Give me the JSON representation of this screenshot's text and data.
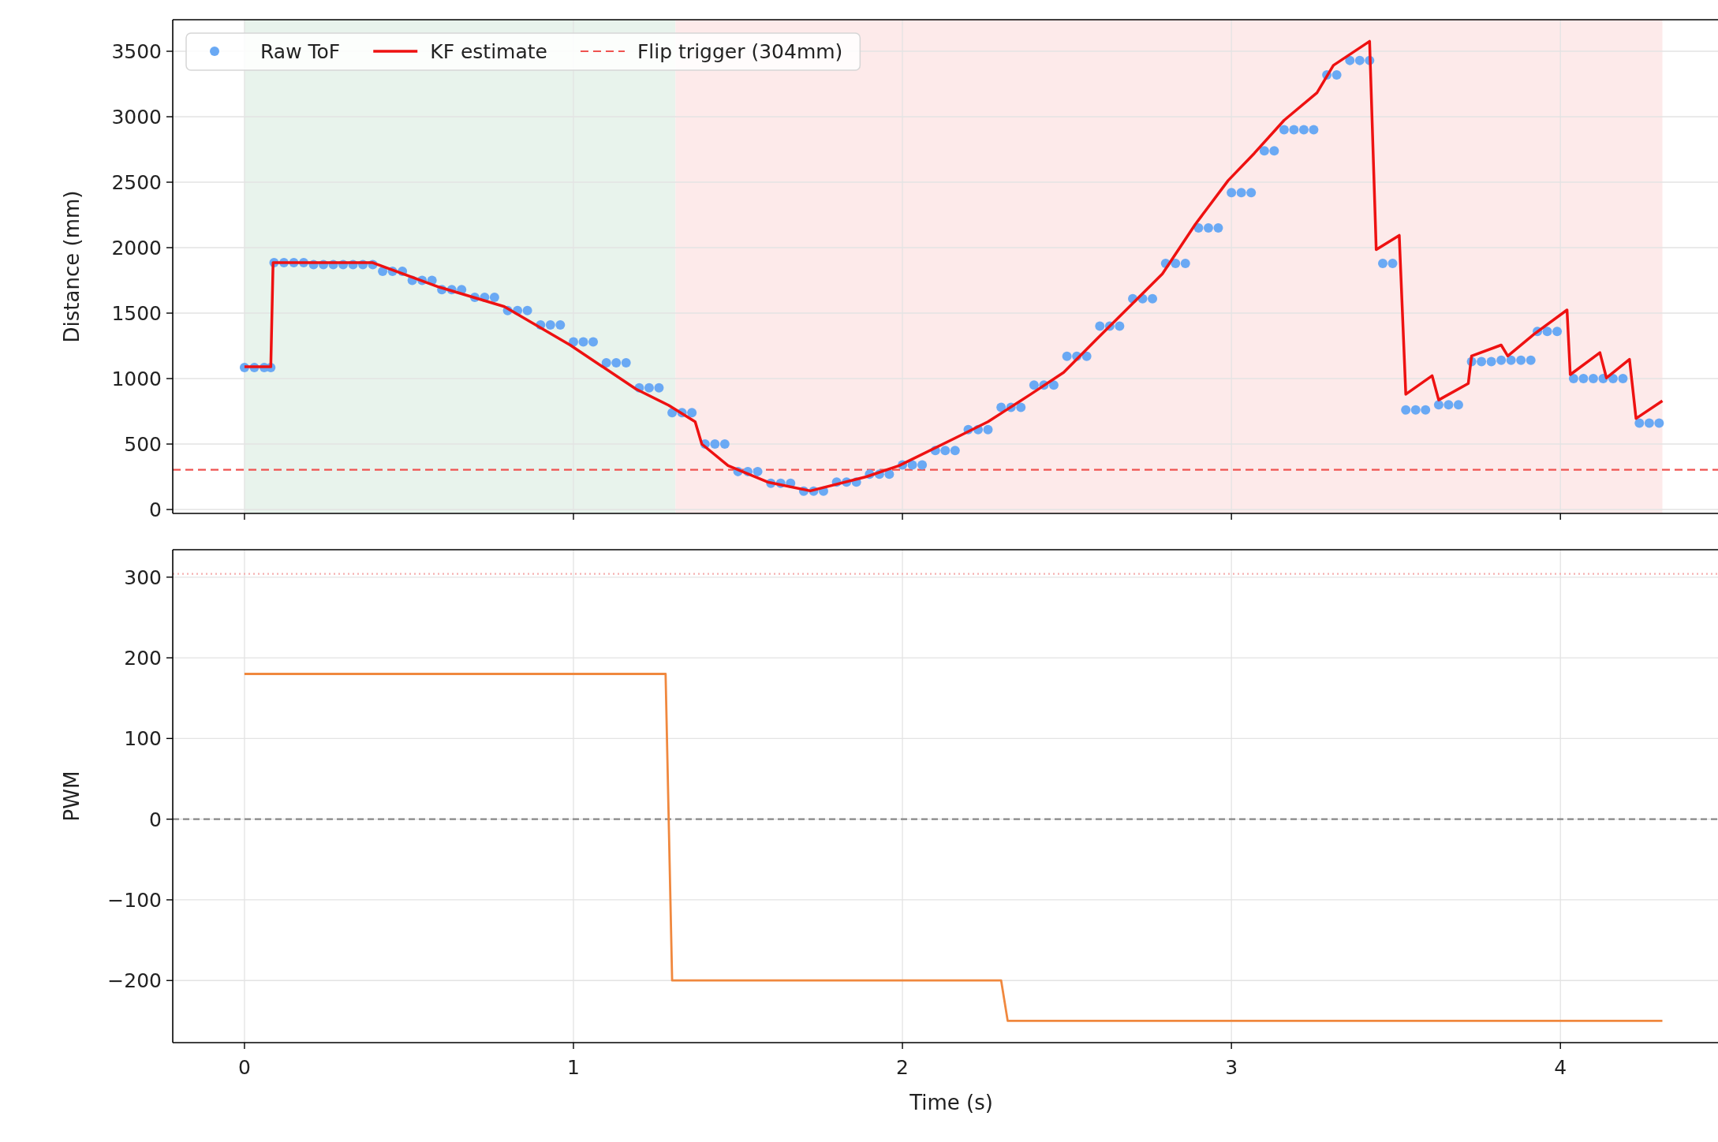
{
  "figure": {
    "charts": [
      {
        "chart_data": {
          "type": "line",
          "ylabel": "Distance (mm)",
          "xlim": [
            -0.218,
            4.479
          ],
          "ylim": [
            -30,
            3741
          ],
          "grid": true,
          "yticks": [
            0,
            500,
            1000,
            1500,
            2000,
            2500,
            3000,
            3500
          ],
          "series": [
            {
              "name": "Raw ToF",
              "type": "scatter",
              "color": "#6aa9f4",
              "x": [
                0,
                0.03,
                0.06,
                0.08,
                0.09,
                0.12,
                0.15,
                0.18,
                0.21,
                0.24,
                0.27,
                0.3,
                0.33,
                0.36,
                0.39,
                0.42,
                0.45,
                0.48,
                0.51,
                0.54,
                0.57,
                0.6,
                0.63,
                0.66,
                0.7,
                0.73,
                0.76,
                0.8,
                0.83,
                0.86,
                0.9,
                0.93,
                0.96,
                1.0,
                1.03,
                1.06,
                1.1,
                1.13,
                1.16,
                1.2,
                1.23,
                1.26,
                1.3,
                1.33,
                1.36,
                1.4,
                1.43,
                1.46,
                1.5,
                1.53,
                1.56,
                1.6,
                1.63,
                1.66,
                1.7,
                1.73,
                1.76,
                1.8,
                1.83,
                1.86,
                1.9,
                1.93,
                1.96,
                2.0,
                2.03,
                2.06,
                2.1,
                2.13,
                2.16,
                2.2,
                2.23,
                2.26,
                2.3,
                2.33,
                2.36,
                2.4,
                2.43,
                2.46,
                2.5,
                2.53,
                2.56,
                2.6,
                2.63,
                2.66,
                2.7,
                2.73,
                2.76,
                2.8,
                2.83,
                2.86,
                2.9,
                2.93,
                2.96,
                3.0,
                3.03,
                3.06,
                3.1,
                3.13,
                3.16,
                3.19,
                3.22,
                3.25,
                3.29,
                3.32,
                3.36,
                3.39,
                3.42,
                3.46,
                3.49,
                3.53,
                3.56,
                3.59,
                3.63,
                3.66,
                3.69,
                3.73,
                3.76,
                3.79,
                3.82,
                3.85,
                3.88,
                3.91,
                3.93,
                3.96,
                3.99,
                4.04,
                4.07,
                4.1,
                4.13,
                4.16,
                4.19,
                4.24,
                4.27,
                4.3
              ],
              "values": [
                1085,
                1085,
                1085,
                1085,
                1885,
                1885,
                1885,
                1885,
                1870,
                1870,
                1870,
                1870,
                1870,
                1870,
                1870,
                1820,
                1820,
                1820,
                1750,
                1750,
                1750,
                1680,
                1680,
                1680,
                1620,
                1620,
                1620,
                1520,
                1520,
                1520,
                1410,
                1410,
                1410,
                1280,
                1280,
                1280,
                1120,
                1120,
                1120,
                930,
                930,
                930,
                740,
                740,
                740,
                500,
                500,
                500,
                290,
                290,
                290,
                200,
                200,
                200,
                140,
                140,
                140,
                210,
                210,
                210,
                270,
                270,
                270,
                340,
                340,
                340,
                450,
                450,
                450,
                610,
                610,
                610,
                780,
                780,
                780,
                950,
                950,
                950,
                1170,
                1170,
                1170,
                1400,
                1400,
                1400,
                1610,
                1610,
                1610,
                1880,
                1880,
                1880,
                2150,
                2150,
                2150,
                2420,
                2420,
                2420,
                2740,
                2740,
                2900,
                2900,
                2900,
                2900,
                3320,
                3320,
                3430,
                3430,
                3430,
                1880,
                1880,
                760,
                760,
                760,
                800,
                800,
                800,
                1130,
                1130,
                1130,
                1140,
                1140,
                1140,
                1140,
                1360,
                1360,
                1360,
                1000,
                1000,
                1000,
                1000,
                1000,
                1000,
                660,
                660,
                660
              ]
            },
            {
              "name": "KF estimate",
              "type": "line",
              "color": "#ee1111",
              "x": [
                0,
                0.08,
                0.087,
                0.39,
                0.59,
                0.79,
                0.99,
                1.19,
                1.29,
                1.37,
                1.39,
                1.47,
                1.59,
                1.72,
                1.89,
                1.99,
                2.16,
                2.26,
                2.39,
                2.49,
                2.59,
                2.69,
                2.79,
                2.89,
                2.99,
                3.07,
                3.16,
                3.26,
                3.31,
                3.42,
                3.44,
                3.51,
                3.53,
                3.61,
                3.63,
                3.72,
                3.73,
                3.82,
                3.84,
                3.92,
                4.02,
                4.03,
                4.12,
                4.14,
                4.21,
                4.23,
                4.31
              ],
              "values": [
                1090,
                1090,
                1885,
                1885,
                1700,
                1550,
                1256,
                920,
                795,
                670,
                500,
                335,
                210,
                142,
                250,
                335,
                545,
                670,
                880,
                1047,
                1300,
                1550,
                1800,
                2178,
                2513,
                2722,
                2973,
                3183,
                3392,
                3576,
                1985,
                2094,
                880,
                1022,
                837,
                963,
                1173,
                1256,
                1173,
                1340,
                1524,
                1030,
                1198,
                1005,
                1147,
                695,
                830
              ]
            }
          ],
          "legend": true,
          "bands": [
            {
              "axis": "x",
              "from": 0,
              "to": 1.31,
              "color": "#e8f3ec"
            },
            {
              "axis": "x",
              "from": 1.31,
              "to": 4.31,
              "color": "#fdeaea"
            }
          ],
          "ref_lines": [
            {
              "axis": "y",
              "value": 304,
              "label": "Flip trigger (304mm)",
              "color": "#ef5350"
            }
          ]
        }
      },
      {
        "chart_data": {
          "type": "line",
          "xlabel": "Time (s)",
          "ylabel": "PWM",
          "xlim": [
            -0.218,
            4.479
          ],
          "ylim": [
            -277,
            334
          ],
          "grid": true,
          "xticks": [
            0,
            1,
            2,
            3,
            4
          ],
          "yticks": [
            {
              "value": -200,
              "label": "−200"
            },
            {
              "value": -100,
              "label": "−100"
            },
            0,
            100,
            200,
            300
          ],
          "series": [
            {
              "type": "line",
              "color": "#f0883e",
              "x": [
                0,
                1.28,
                1.3,
                2.3,
                2.32,
                4.31
              ],
              "values": [
                180,
                180,
                -200,
                -200,
                -250,
                -250
              ]
            }
          ],
          "ref_lines": [
            {
              "axis": "y",
              "value": 304,
              "color": "#f6b0b0"
            },
            {
              "axis": "y",
              "value": 0,
              "color": "#888888"
            }
          ]
        }
      }
    ]
  }
}
